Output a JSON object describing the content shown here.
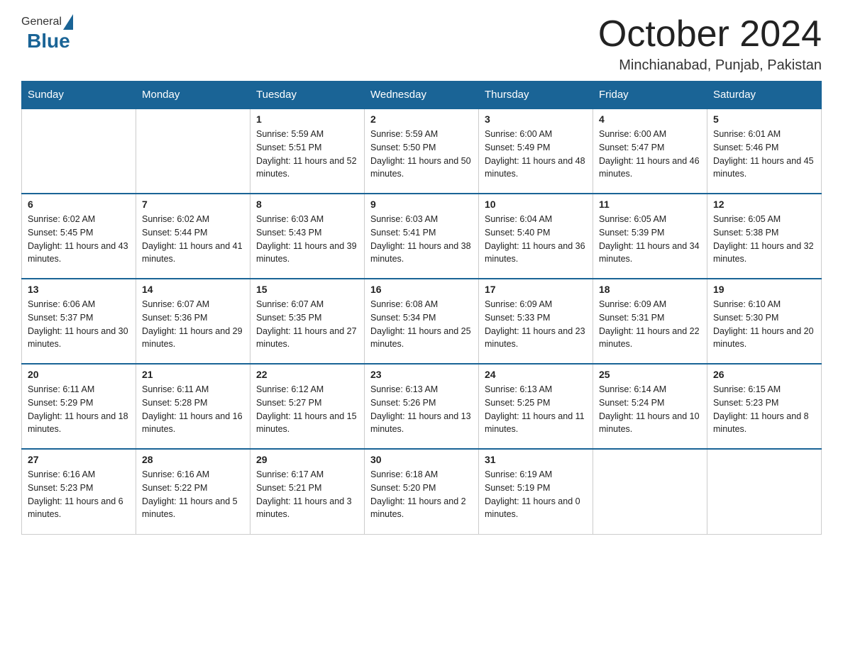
{
  "header": {
    "logo": {
      "general": "General",
      "blue": "Blue"
    },
    "title": "October 2024",
    "location": "Minchianabad, Punjab, Pakistan"
  },
  "calendar": {
    "days_of_week": [
      "Sunday",
      "Monday",
      "Tuesday",
      "Wednesday",
      "Thursday",
      "Friday",
      "Saturday"
    ],
    "weeks": [
      [
        {
          "day": "",
          "info": ""
        },
        {
          "day": "",
          "info": ""
        },
        {
          "day": "1",
          "sunrise": "5:59 AM",
          "sunset": "5:51 PM",
          "daylight": "11 hours and 52 minutes."
        },
        {
          "day": "2",
          "sunrise": "5:59 AM",
          "sunset": "5:50 PM",
          "daylight": "11 hours and 50 minutes."
        },
        {
          "day": "3",
          "sunrise": "6:00 AM",
          "sunset": "5:49 PM",
          "daylight": "11 hours and 48 minutes."
        },
        {
          "day": "4",
          "sunrise": "6:00 AM",
          "sunset": "5:47 PM",
          "daylight": "11 hours and 46 minutes."
        },
        {
          "day": "5",
          "sunrise": "6:01 AM",
          "sunset": "5:46 PM",
          "daylight": "11 hours and 45 minutes."
        }
      ],
      [
        {
          "day": "6",
          "sunrise": "6:02 AM",
          "sunset": "5:45 PM",
          "daylight": "11 hours and 43 minutes."
        },
        {
          "day": "7",
          "sunrise": "6:02 AM",
          "sunset": "5:44 PM",
          "daylight": "11 hours and 41 minutes."
        },
        {
          "day": "8",
          "sunrise": "6:03 AM",
          "sunset": "5:43 PM",
          "daylight": "11 hours and 39 minutes."
        },
        {
          "day": "9",
          "sunrise": "6:03 AM",
          "sunset": "5:41 PM",
          "daylight": "11 hours and 38 minutes."
        },
        {
          "day": "10",
          "sunrise": "6:04 AM",
          "sunset": "5:40 PM",
          "daylight": "11 hours and 36 minutes."
        },
        {
          "day": "11",
          "sunrise": "6:05 AM",
          "sunset": "5:39 PM",
          "daylight": "11 hours and 34 minutes."
        },
        {
          "day": "12",
          "sunrise": "6:05 AM",
          "sunset": "5:38 PM",
          "daylight": "11 hours and 32 minutes."
        }
      ],
      [
        {
          "day": "13",
          "sunrise": "6:06 AM",
          "sunset": "5:37 PM",
          "daylight": "11 hours and 30 minutes."
        },
        {
          "day": "14",
          "sunrise": "6:07 AM",
          "sunset": "5:36 PM",
          "daylight": "11 hours and 29 minutes."
        },
        {
          "day": "15",
          "sunrise": "6:07 AM",
          "sunset": "5:35 PM",
          "daylight": "11 hours and 27 minutes."
        },
        {
          "day": "16",
          "sunrise": "6:08 AM",
          "sunset": "5:34 PM",
          "daylight": "11 hours and 25 minutes."
        },
        {
          "day": "17",
          "sunrise": "6:09 AM",
          "sunset": "5:33 PM",
          "daylight": "11 hours and 23 minutes."
        },
        {
          "day": "18",
          "sunrise": "6:09 AM",
          "sunset": "5:31 PM",
          "daylight": "11 hours and 22 minutes."
        },
        {
          "day": "19",
          "sunrise": "6:10 AM",
          "sunset": "5:30 PM",
          "daylight": "11 hours and 20 minutes."
        }
      ],
      [
        {
          "day": "20",
          "sunrise": "6:11 AM",
          "sunset": "5:29 PM",
          "daylight": "11 hours and 18 minutes."
        },
        {
          "day": "21",
          "sunrise": "6:11 AM",
          "sunset": "5:28 PM",
          "daylight": "11 hours and 16 minutes."
        },
        {
          "day": "22",
          "sunrise": "6:12 AM",
          "sunset": "5:27 PM",
          "daylight": "11 hours and 15 minutes."
        },
        {
          "day": "23",
          "sunrise": "6:13 AM",
          "sunset": "5:26 PM",
          "daylight": "11 hours and 13 minutes."
        },
        {
          "day": "24",
          "sunrise": "6:13 AM",
          "sunset": "5:25 PM",
          "daylight": "11 hours and 11 minutes."
        },
        {
          "day": "25",
          "sunrise": "6:14 AM",
          "sunset": "5:24 PM",
          "daylight": "11 hours and 10 minutes."
        },
        {
          "day": "26",
          "sunrise": "6:15 AM",
          "sunset": "5:23 PM",
          "daylight": "11 hours and 8 minutes."
        }
      ],
      [
        {
          "day": "27",
          "sunrise": "6:16 AM",
          "sunset": "5:23 PM",
          "daylight": "11 hours and 6 minutes."
        },
        {
          "day": "28",
          "sunrise": "6:16 AM",
          "sunset": "5:22 PM",
          "daylight": "11 hours and 5 minutes."
        },
        {
          "day": "29",
          "sunrise": "6:17 AM",
          "sunset": "5:21 PM",
          "daylight": "11 hours and 3 minutes."
        },
        {
          "day": "30",
          "sunrise": "6:18 AM",
          "sunset": "5:20 PM",
          "daylight": "11 hours and 2 minutes."
        },
        {
          "day": "31",
          "sunrise": "6:19 AM",
          "sunset": "5:19 PM",
          "daylight": "11 hours and 0 minutes."
        },
        {
          "day": "",
          "info": ""
        },
        {
          "day": "",
          "info": ""
        }
      ]
    ],
    "labels": {
      "sunrise": "Sunrise:",
      "sunset": "Sunset:",
      "daylight": "Daylight:"
    }
  }
}
